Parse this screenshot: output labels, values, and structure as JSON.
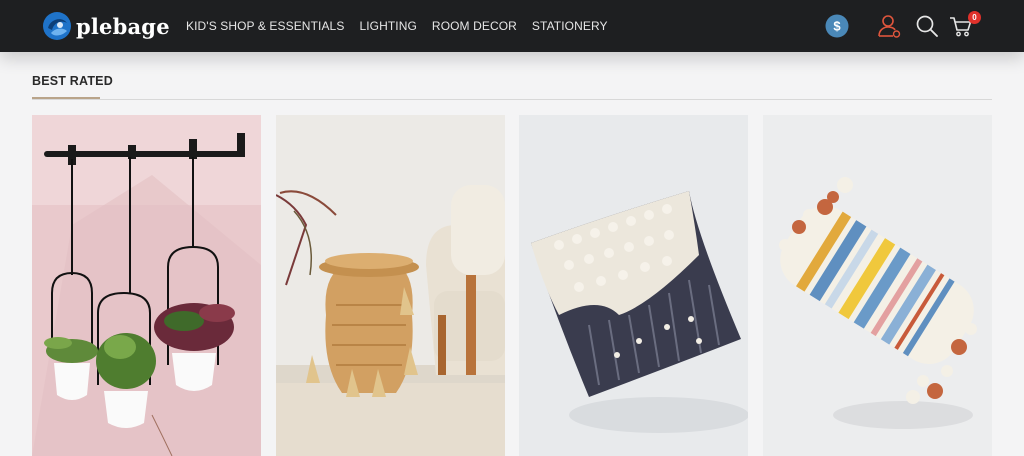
{
  "brand": {
    "name": "plebage"
  },
  "nav": {
    "items": [
      {
        "label": "KID'S SHOP & ESSENTIALS"
      },
      {
        "label": "LIGHTING"
      },
      {
        "label": "ROOM DECOR"
      },
      {
        "label": "STATIONERY"
      }
    ]
  },
  "header_icons": {
    "currency": {
      "icon": "currency-dollar-icon",
      "symbol": "$",
      "color": "#4a88b8"
    },
    "account": {
      "icon": "user-icon",
      "color": "#e0563d"
    },
    "search": {
      "icon": "search-icon"
    },
    "cart": {
      "icon": "cart-icon",
      "count": "0",
      "badge_color": "#e0312b"
    }
  },
  "section": {
    "title": "BEST RATED",
    "accent_color": "#b9a48a"
  },
  "products": [
    {
      "name": "hanging-planters-image"
    },
    {
      "name": "woven-basket-image"
    },
    {
      "name": "textured-square-pillow-image"
    },
    {
      "name": "striped-tassel-lumbar-pillow-image"
    }
  ]
}
